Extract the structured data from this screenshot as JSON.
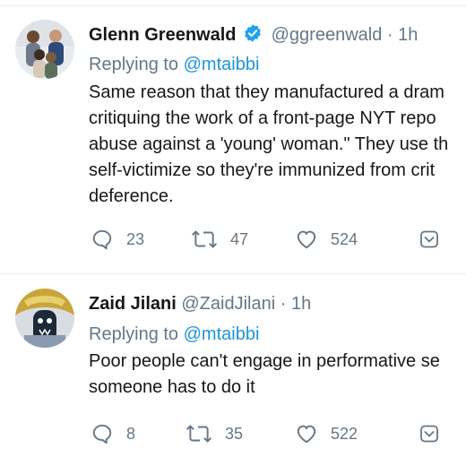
{
  "tweets": [
    {
      "name": "Glenn Greenwald",
      "verified": true,
      "handle": "@ggreenwald",
      "separator": "·",
      "time": "1h",
      "replying_prefix": "Replying to ",
      "replying_to": "@mtaibbi",
      "body_lines": [
        "Same reason that they manufactured a dram",
        "critiquing the work of a front-page NYT repo",
        "abuse against a 'young' woman.\" They use th",
        "self-victimize so they're immunized from crit",
        "deference."
      ],
      "replies": "23",
      "retweets": "47",
      "likes": "524"
    },
    {
      "name": "Zaid Jilani",
      "verified": false,
      "handle": "@ZaidJilani",
      "separator": "·",
      "time": "1h",
      "replying_prefix": "Replying to ",
      "replying_to": "@mtaibbi",
      "body_lines": [
        "Poor people can't engage in performative se",
        "someone has to do it"
      ],
      "replies": "8",
      "retweets": "35",
      "likes": "522"
    }
  ],
  "icons": {
    "reply": "reply-icon",
    "retweet": "retweet-icon",
    "like": "heart-icon",
    "share": "share-icon",
    "verified": "verified-badge-icon"
  },
  "colors": {
    "text": "#14171a",
    "secondary": "#657786",
    "link": "#1b95e0",
    "verified": "#1da1f2",
    "divider": "#e6ecf0"
  }
}
